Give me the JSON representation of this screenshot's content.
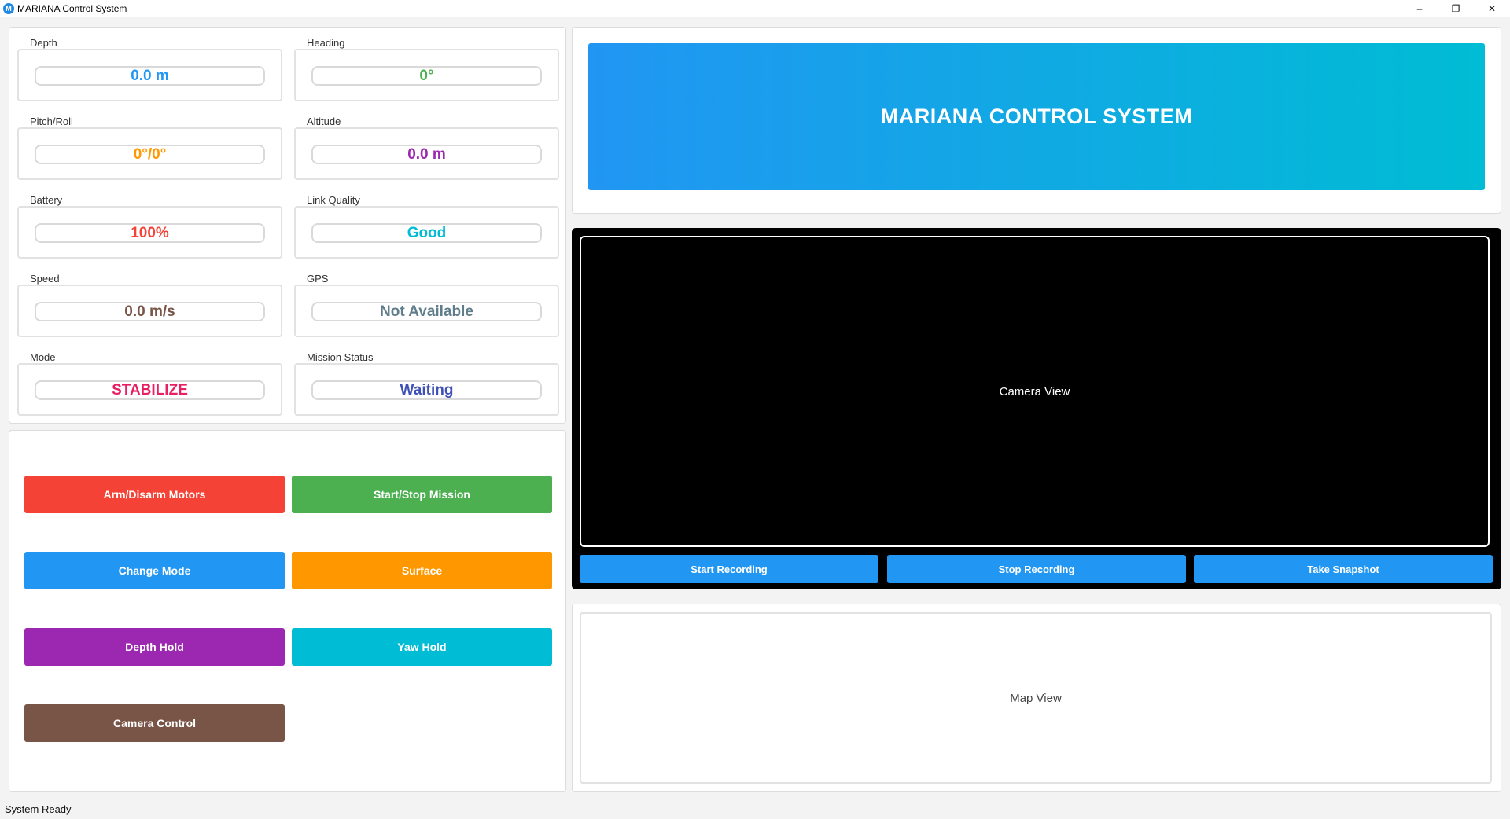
{
  "window": {
    "title": "MARIANA Control System",
    "icon_letter": "M",
    "minimize": "–",
    "maximize": "❐",
    "close": "✕"
  },
  "telemetry": [
    {
      "label": "Depth",
      "value": "0.0 m",
      "color": "#2196f3"
    },
    {
      "label": "Heading",
      "value": "0°",
      "color": "#4caf50"
    },
    {
      "label": "Pitch/Roll",
      "value": "0°/0°",
      "color": "#ff9800"
    },
    {
      "label": "Altitude",
      "value": "0.0 m",
      "color": "#9c27b0"
    },
    {
      "label": "Battery",
      "value": "100%",
      "color": "#f44336"
    },
    {
      "label": "Link Quality",
      "value": "Good",
      "color": "#00bcd4"
    },
    {
      "label": "Speed",
      "value": "0.0 m/s",
      "color": "#795548"
    },
    {
      "label": "GPS",
      "value": "Not Available",
      "color": "#607d8b"
    },
    {
      "label": "Mode",
      "value": "STABILIZE",
      "color": "#e91e63"
    },
    {
      "label": "Mission Status",
      "value": "Waiting",
      "color": "#3f51b5"
    }
  ],
  "controls": [
    {
      "label": "Arm/Disarm Motors",
      "color": "#f44336"
    },
    {
      "label": "Start/Stop Mission",
      "color": "#4caf50"
    },
    {
      "label": "Change Mode",
      "color": "#2196f3"
    },
    {
      "label": "Surface",
      "color": "#ff9800"
    },
    {
      "label": "Depth Hold",
      "color": "#9c27b0"
    },
    {
      "label": "Yaw Hold",
      "color": "#00bcd4"
    },
    {
      "label": "Camera Control",
      "color": "#795548"
    }
  ],
  "header": {
    "title": "MARIANA CONTROL SYSTEM",
    "gradient_start": "#2196f3",
    "gradient_end": "#00bcd4"
  },
  "camera": {
    "view_label": "Camera View",
    "start_recording": "Start Recording",
    "stop_recording": "Stop Recording",
    "take_snapshot": "Take Snapshot"
  },
  "map": {
    "view_label": "Map View"
  },
  "status_bar": {
    "text": "System Ready"
  }
}
